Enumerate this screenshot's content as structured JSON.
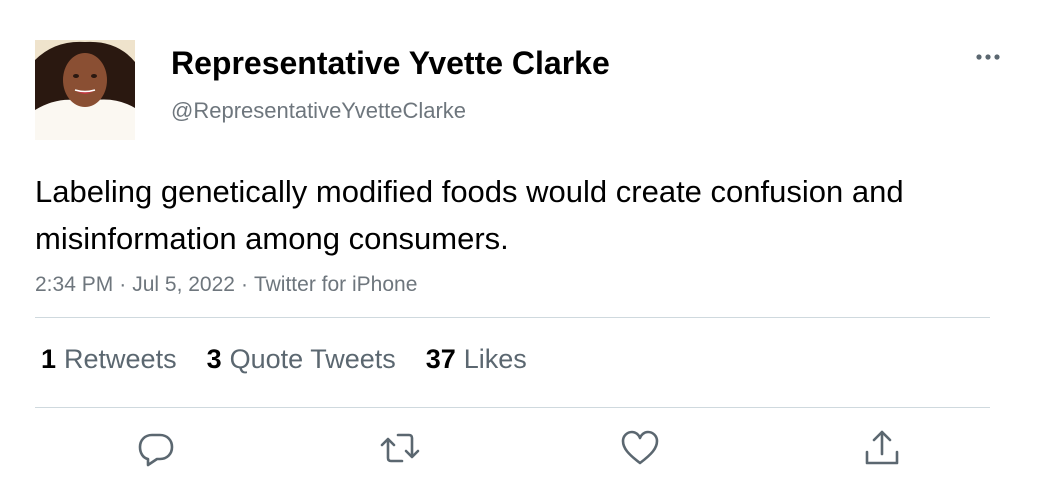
{
  "tweet": {
    "author": {
      "display_name": "Representative Yvette Clarke",
      "handle": "@RepresentativeYvetteClarke"
    },
    "text": "Labeling genetically modified foods would create confusion and misinformation among consumers.",
    "meta": {
      "time": "2:34 PM",
      "date": "Jul 5, 2022",
      "source": "Twitter for iPhone",
      "separator": "·"
    },
    "stats": {
      "retweets": {
        "count": "1",
        "label": "Retweets"
      },
      "quotes": {
        "count": "3",
        "label": "Quote Tweets"
      },
      "likes": {
        "count": "37",
        "label": "Likes"
      }
    }
  },
  "icons": {
    "more": "more-horizontal-icon",
    "reply": "reply-icon",
    "retweet": "retweet-icon",
    "like": "heart-icon",
    "share": "share-icon"
  },
  "colors": {
    "secondary_text": "#6e767d",
    "icon": "#5b6770",
    "divider": "#cfd9de"
  }
}
